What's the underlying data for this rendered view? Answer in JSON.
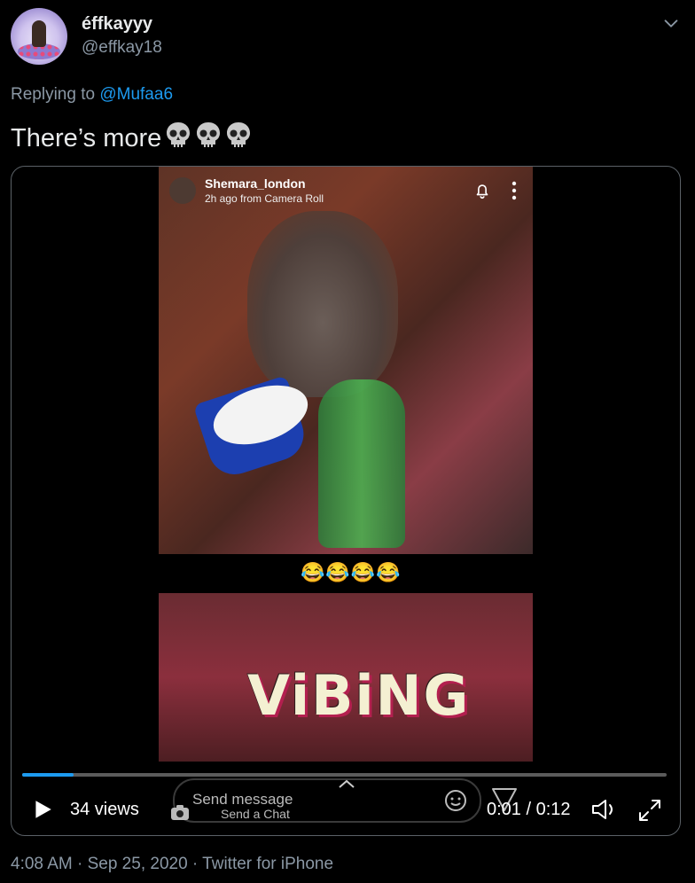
{
  "author": {
    "display_name": "éffkayyy",
    "handle": "@effkay18"
  },
  "reply": {
    "prefix": "Replying to ",
    "to": "@Mufaa6"
  },
  "tweet": {
    "text": "There’s more",
    "emoji_count": 3,
    "emoji_icon": "skull-icon"
  },
  "snapchat": {
    "username": "Shemara_london",
    "subtitle": "2h ago from Camera Roll",
    "emoji_caption": "😂😂😂😂",
    "overlay_text": "ViBiNG",
    "send_message": "Send message",
    "send_chat": "Send a Chat"
  },
  "player": {
    "views": "34 views",
    "time": "0:01 / 0:12",
    "progress": 0.08
  },
  "footer": {
    "meta": "4:08 AM · Sep 25, 2020 · Twitter for iPhone"
  },
  "colors": {
    "accent": "#1d9bf0",
    "text_primary": "#e7e9ea",
    "text_secondary": "#8b98a5",
    "border": "#5b6167",
    "background": "#000000"
  }
}
